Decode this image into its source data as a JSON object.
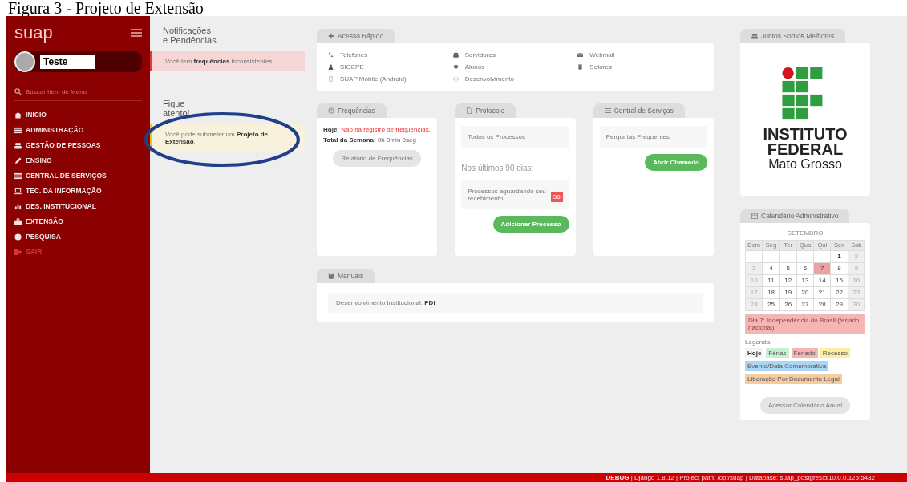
{
  "caption": "Figura 3 - Projeto de Extensão",
  "sidebar": {
    "brand": "suap",
    "user": "Teste",
    "search": {
      "placeholder": "Buscar Item de Menu"
    },
    "items": [
      {
        "label": "INÍCIO",
        "kind": "link"
      },
      {
        "label": "ADMINISTRAÇÃO",
        "kind": "link"
      },
      {
        "label": "GESTÃO DE PESSOAS",
        "kind": "link"
      },
      {
        "label": "ENSINO",
        "kind": "link"
      },
      {
        "label": "CENTRAL DE SERVIÇOS",
        "kind": "link"
      },
      {
        "label": "TEC. DA INFORMAÇÃO",
        "kind": "link"
      },
      {
        "label": "DES. INSTITUCIONAL",
        "kind": "link"
      },
      {
        "label": "EXTENSÃO",
        "kind": "link"
      },
      {
        "label": "PESQUISA",
        "kind": "link"
      },
      {
        "label": "SAIR",
        "kind": "logout"
      }
    ]
  },
  "notifications": {
    "title": "Notificações",
    "subtitle": "e Pendências",
    "items": [
      {
        "text": "Você tem **frequências** inconsistentes.",
        "kind": "danger"
      }
    ]
  },
  "alerts": {
    "title": "Fique",
    "subtitle": "atento!",
    "items": [
      {
        "text": "Você pode submeter um **Projeto de Extensão**.",
        "kind": "warning"
      }
    ]
  },
  "quick_access": {
    "title": "Acesso Rápido",
    "columns": [
      [
        "Telefones",
        "SIGEPE",
        "SUAP Mobile (Android)"
      ],
      [
        "Servidores",
        "Alunos",
        "Desenvolvimento"
      ],
      [
        "Webmail",
        "Setores"
      ]
    ]
  },
  "frequencias": {
    "title": "Frequências",
    "today_label": "Hoje:",
    "today_value": "Não há registro de frequências.",
    "week_label": "Total da Semana:",
    "week_value": "0h 0min 0seg",
    "button": "Relatório de Frequências"
  },
  "protocolo": {
    "title": "Protocolo",
    "all": "Todos os Processos",
    "period": "Nos últimos 90 dias:",
    "pending": "Processos aguardando seu recebimento",
    "pending_count": "56",
    "button": "Adicionar Processo"
  },
  "central": {
    "title": "Central de Serviços",
    "faq": "Perguntas Frequentes",
    "button": "Abrir Chamado"
  },
  "manuais": {
    "title": "Manuais",
    "label": "Desenvolvimento Institucional:",
    "link": "PDI"
  },
  "juntos": {
    "title": "Juntos Somos Melhores",
    "logo_lines": [
      "INSTITUTO",
      "FEDERAL",
      "Mato Grosso"
    ]
  },
  "calendar": {
    "title": "Calendário Administrativo",
    "month": "SETEMBRO",
    "weekdays": [
      "Dom",
      "Seg",
      "Ter",
      "Qua",
      "Qui",
      "Sex",
      "Sab"
    ],
    "weeks": [
      [
        {
          "kind": "blank"
        },
        {
          "kind": "blank"
        },
        {
          "kind": "blank"
        },
        {
          "kind": "blank"
        },
        {
          "kind": "blank"
        },
        {
          "kind": "day",
          "day": "1",
          "weekend": false,
          "today": true,
          "holiday": false
        },
        {
          "kind": "day",
          "day": "2",
          "weekend": true,
          "today": false,
          "holiday": false
        }
      ],
      [
        {
          "kind": "day",
          "day": "3",
          "weekend": true,
          "today": false,
          "holiday": false
        },
        {
          "kind": "day",
          "day": "4",
          "weekend": false,
          "today": false,
          "holiday": false
        },
        {
          "kind": "day",
          "day": "5",
          "weekend": false,
          "today": false,
          "holiday": false
        },
        {
          "kind": "day",
          "day": "6",
          "weekend": false,
          "today": false,
          "holiday": false
        },
        {
          "kind": "day",
          "day": "7",
          "weekend": false,
          "today": false,
          "holiday": true
        },
        {
          "kind": "day",
          "day": "8",
          "weekend": false,
          "today": false,
          "holiday": false
        },
        {
          "kind": "day",
          "day": "9",
          "weekend": true,
          "today": false,
          "holiday": false
        }
      ],
      [
        {
          "kind": "day",
          "day": "10",
          "weekend": true,
          "today": false,
          "holiday": false
        },
        {
          "kind": "day",
          "day": "11",
          "weekend": false,
          "today": false,
          "holiday": false
        },
        {
          "kind": "day",
          "day": "12",
          "weekend": false,
          "today": false,
          "holiday": false
        },
        {
          "kind": "day",
          "day": "13",
          "weekend": false,
          "today": false,
          "holiday": false
        },
        {
          "kind": "day",
          "day": "14",
          "weekend": false,
          "today": false,
          "holiday": false
        },
        {
          "kind": "day",
          "day": "15",
          "weekend": false,
          "today": false,
          "holiday": false
        },
        {
          "kind": "day",
          "day": "16",
          "weekend": true,
          "today": false,
          "holiday": false
        }
      ],
      [
        {
          "kind": "day",
          "day": "17",
          "weekend": true,
          "today": false,
          "holiday": false
        },
        {
          "kind": "day",
          "day": "18",
          "weekend": false,
          "today": false,
          "holiday": false
        },
        {
          "kind": "day",
          "day": "19",
          "weekend": false,
          "today": false,
          "holiday": false
        },
        {
          "kind": "day",
          "day": "20",
          "weekend": false,
          "today": false,
          "holiday": false
        },
        {
          "kind": "day",
          "day": "21",
          "weekend": false,
          "today": false,
          "holiday": false
        },
        {
          "kind": "day",
          "day": "22",
          "weekend": false,
          "today": false,
          "holiday": false
        },
        {
          "kind": "day",
          "day": "23",
          "weekend": true,
          "today": false,
          "holiday": false
        }
      ],
      [
        {
          "kind": "day",
          "day": "24",
          "weekend": true,
          "today": false,
          "holiday": false
        },
        {
          "kind": "day",
          "day": "25",
          "weekend": false,
          "today": false,
          "holiday": false
        },
        {
          "kind": "day",
          "day": "26",
          "weekend": false,
          "today": false,
          "holiday": false
        },
        {
          "kind": "day",
          "day": "27",
          "weekend": false,
          "today": false,
          "holiday": false
        },
        {
          "kind": "day",
          "day": "28",
          "weekend": false,
          "today": false,
          "holiday": false
        },
        {
          "kind": "day",
          "day": "29",
          "weekend": false,
          "today": false,
          "holiday": false
        },
        {
          "kind": "day",
          "day": "30",
          "weekend": true,
          "today": false,
          "holiday": false
        }
      ]
    ],
    "event": "Dia 7: Independência do Brasil (feriado nacional).",
    "legend_title": "Legenda:",
    "legend": [
      {
        "label": "Hoje",
        "color": "#f4f4f4"
      },
      {
        "label": "Férias",
        "color": "#c6f0d2"
      },
      {
        "label": "Feriado",
        "color": "#f5b5b5"
      },
      {
        "label": "Recesso",
        "color": "#faf0a0"
      },
      {
        "label": "Evento/Data Comemorativa",
        "color": "#a9d6f5"
      },
      {
        "label": "Liberação Por Documento Legal",
        "color": "#f7cba2"
      }
    ],
    "button": "Acessar Calendário Anual"
  },
  "footer": {
    "debug": "DEBUG",
    "text": "| Django 1.8.12 | Project path: /opt/suap | Database: suap_postgres@10.0.0.125:5432"
  }
}
